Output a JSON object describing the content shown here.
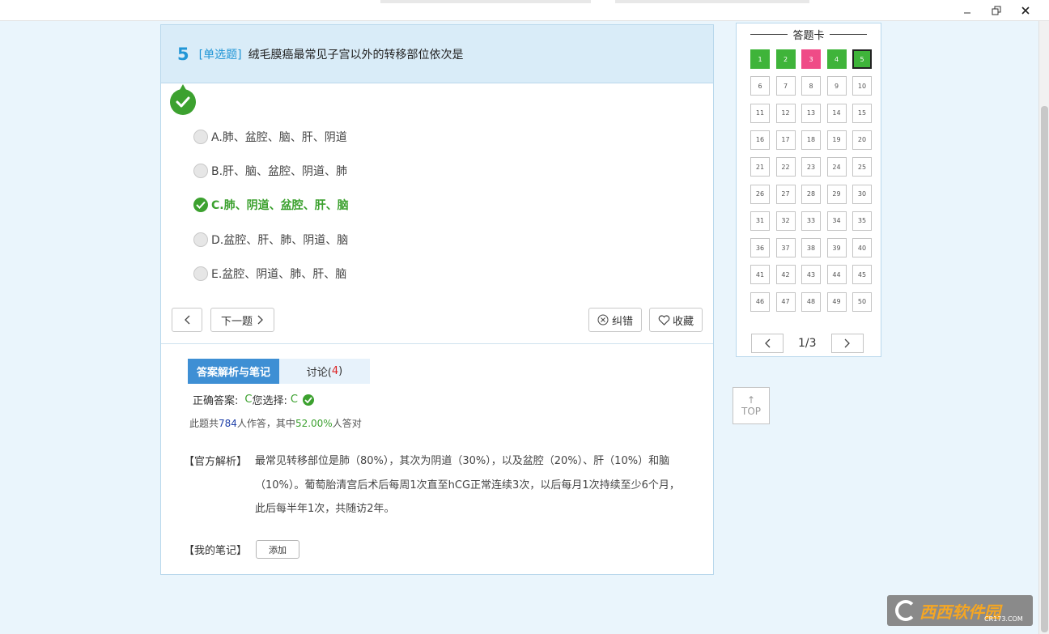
{
  "window": {
    "minimize_icon": "minimize-icon",
    "restore_icon": "restore-icon",
    "close_icon": "close-icon"
  },
  "question": {
    "number": "5",
    "type": "[单选题]",
    "text": "绒毛膜癌最常见子宫以外的转移部位依次是",
    "options": [
      {
        "label": "A.肺、盆腔、脑、肝、阴道",
        "selected": false
      },
      {
        "label": "B.肝、脑、盆腔、阴道、肺",
        "selected": false
      },
      {
        "label": "C.肺、阴道、盆腔、肝、脑",
        "selected": true
      },
      {
        "label": "D.盆腔、肝、肺、阴道、脑",
        "selected": false
      },
      {
        "label": "E.盆腔、阴道、肺、肝、脑",
        "selected": false
      }
    ]
  },
  "actions": {
    "prev_icon": "chevron-left-icon",
    "next_label": "下一题",
    "report_label": "纠错",
    "favorite_label": "收藏"
  },
  "tabs": {
    "analysis_label": "答案解析与笔记",
    "discuss_label": "讨论(",
    "discuss_count": "4",
    "discuss_close": ")"
  },
  "answer": {
    "correct_label": "正确答案:",
    "correct_value": "C",
    "your_label": "您选择:",
    "your_value": "C"
  },
  "stats": {
    "prefix": "此题共",
    "count": "784",
    "middle": "人作答，其中",
    "rate": "52.00%",
    "suffix": "人答对"
  },
  "explanation": {
    "label": "【官方解析】",
    "text": "最常见转移部位是肺（80%），其次为阴道（30%），以及盆腔（20%）、肝（10%）和脑（10%）。葡萄胎清宫后术后每周1次直至hCG正常连续3次，以后每月1次持续至少6个月，此后每半年1次，共随访2年。"
  },
  "notes": {
    "label": "【我的笔记】",
    "add_label": "添加"
  },
  "answer_card": {
    "title": "答题卡",
    "cells": [
      {
        "n": "1",
        "s": "ok"
      },
      {
        "n": "2",
        "s": "ok"
      },
      {
        "n": "3",
        "s": "bad"
      },
      {
        "n": "4",
        "s": "ok"
      },
      {
        "n": "5",
        "s": "cur"
      },
      {
        "n": "6",
        "s": ""
      },
      {
        "n": "7",
        "s": ""
      },
      {
        "n": "8",
        "s": ""
      },
      {
        "n": "9",
        "s": ""
      },
      {
        "n": "10",
        "s": ""
      },
      {
        "n": "11",
        "s": ""
      },
      {
        "n": "12",
        "s": ""
      },
      {
        "n": "13",
        "s": ""
      },
      {
        "n": "14",
        "s": ""
      },
      {
        "n": "15",
        "s": ""
      },
      {
        "n": "16",
        "s": ""
      },
      {
        "n": "17",
        "s": ""
      },
      {
        "n": "18",
        "s": ""
      },
      {
        "n": "19",
        "s": ""
      },
      {
        "n": "20",
        "s": ""
      },
      {
        "n": "21",
        "s": ""
      },
      {
        "n": "22",
        "s": ""
      },
      {
        "n": "23",
        "s": ""
      },
      {
        "n": "24",
        "s": ""
      },
      {
        "n": "25",
        "s": ""
      },
      {
        "n": "26",
        "s": ""
      },
      {
        "n": "27",
        "s": ""
      },
      {
        "n": "28",
        "s": ""
      },
      {
        "n": "29",
        "s": ""
      },
      {
        "n": "30",
        "s": ""
      },
      {
        "n": "31",
        "s": ""
      },
      {
        "n": "32",
        "s": ""
      },
      {
        "n": "33",
        "s": ""
      },
      {
        "n": "34",
        "s": ""
      },
      {
        "n": "35",
        "s": ""
      },
      {
        "n": "36",
        "s": ""
      },
      {
        "n": "37",
        "s": ""
      },
      {
        "n": "38",
        "s": ""
      },
      {
        "n": "39",
        "s": ""
      },
      {
        "n": "40",
        "s": ""
      },
      {
        "n": "41",
        "s": ""
      },
      {
        "n": "42",
        "s": ""
      },
      {
        "n": "43",
        "s": ""
      },
      {
        "n": "44",
        "s": ""
      },
      {
        "n": "45",
        "s": ""
      },
      {
        "n": "46",
        "s": ""
      },
      {
        "n": "47",
        "s": ""
      },
      {
        "n": "48",
        "s": ""
      },
      {
        "n": "49",
        "s": ""
      },
      {
        "n": "50",
        "s": ""
      }
    ],
    "page": "1/3"
  },
  "top_button": {
    "arrow": "↑",
    "label": "TOP"
  },
  "watermark": {
    "text": "西西软件园",
    "sub": "CR173.COM"
  },
  "colors": {
    "accent": "#2196d6",
    "correct": "#3ca12f",
    "wrong": "#ef4b87",
    "tab_active": "#3e8fd4"
  }
}
